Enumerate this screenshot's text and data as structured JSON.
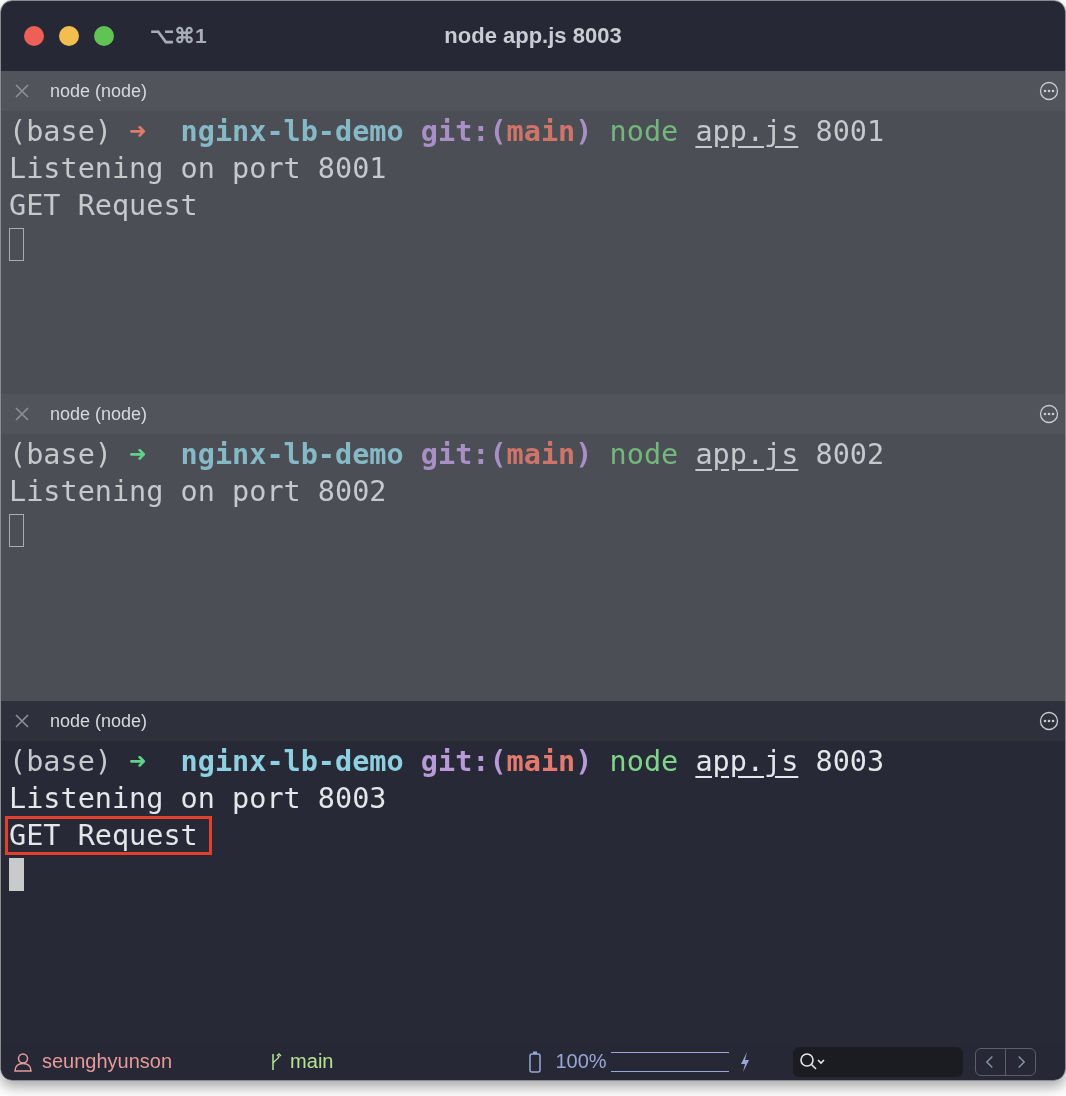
{
  "window": {
    "shortcut": "⌥⌘1",
    "title": "node app.js 8003"
  },
  "panes": [
    {
      "label": "node (node)",
      "focused": false,
      "prompt": {
        "arrow_ok": false,
        "segments": [
          {
            "text": "(base)",
            "kind": "env"
          },
          {
            "text": "➜",
            "kind": "arrow"
          },
          {
            "text": "nginx-lb-demo",
            "kind": "dir"
          },
          {
            "text": "git:(",
            "kind": "git"
          },
          {
            "text": "main",
            "kind": "branch"
          },
          {
            "text": ")",
            "kind": "git"
          },
          {
            "text": "node",
            "kind": "cmd"
          },
          {
            "text": "app.js",
            "kind": "file"
          },
          {
            "text": "8001",
            "kind": "arg"
          }
        ]
      },
      "lines": [
        {
          "text": "Listening on port 8001",
          "highlighted": false
        },
        {
          "text": "GET Request",
          "highlighted": false
        }
      ]
    },
    {
      "label": "node (node)",
      "focused": false,
      "prompt": {
        "arrow_ok": true,
        "segments": [
          {
            "text": "(base)",
            "kind": "env"
          },
          {
            "text": "➜",
            "kind": "arrow"
          },
          {
            "text": "nginx-lb-demo",
            "kind": "dir"
          },
          {
            "text": "git:(",
            "kind": "git"
          },
          {
            "text": "main",
            "kind": "branch"
          },
          {
            "text": ")",
            "kind": "git"
          },
          {
            "text": "node",
            "kind": "cmd"
          },
          {
            "text": "app.js",
            "kind": "file"
          },
          {
            "text": "8002",
            "kind": "arg"
          }
        ]
      },
      "lines": [
        {
          "text": "Listening on port 8002",
          "highlighted": false
        }
      ]
    },
    {
      "label": "node (node)",
      "focused": true,
      "prompt": {
        "arrow_ok": true,
        "segments": [
          {
            "text": "(base)",
            "kind": "env"
          },
          {
            "text": "➜",
            "kind": "arrow"
          },
          {
            "text": "nginx-lb-demo",
            "kind": "dir"
          },
          {
            "text": "git:(",
            "kind": "git"
          },
          {
            "text": "main",
            "kind": "branch"
          },
          {
            "text": ")",
            "kind": "git"
          },
          {
            "text": "node",
            "kind": "cmd"
          },
          {
            "text": "app.js",
            "kind": "file"
          },
          {
            "text": "8003",
            "kind": "arg"
          }
        ]
      },
      "lines": [
        {
          "text": "Listening on port 8003",
          "highlighted": false
        },
        {
          "text": "GET Request",
          "highlighted": true
        }
      ]
    }
  ],
  "status_bar": {
    "user": "seunghyunson",
    "branch": "main",
    "battery": "100%",
    "level": 1
  }
}
